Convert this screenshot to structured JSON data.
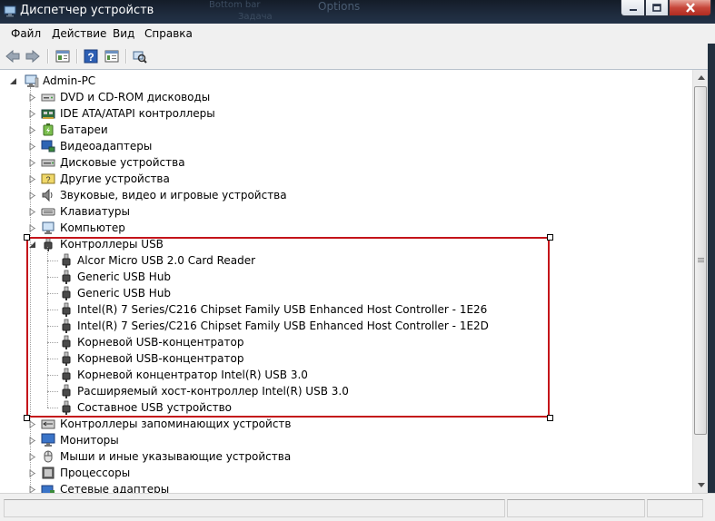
{
  "window": {
    "title": "Диспетчер устройств",
    "background_tabs": [
      "Оptions",
      "Bottom bar",
      "Задача"
    ]
  },
  "menu": [
    "Файл",
    "Действие",
    "Вид",
    "Справка"
  ],
  "toolbar": {
    "icons": [
      "back-arrow-icon",
      "forward-arrow-icon",
      "properties-icon",
      "help-icon",
      "console-tree-icon",
      "scan-hardware-icon"
    ]
  },
  "tree": {
    "root": "Admin-PC",
    "categories_before": [
      {
        "label": "DVD и CD-ROM дисководы",
        "icon": "dvd-drive-icon"
      },
      {
        "label": "IDE ATA/ATAPI контроллеры",
        "icon": "ide-controller-icon"
      },
      {
        "label": "Батареи",
        "icon": "battery-icon"
      },
      {
        "label": "Видеоадаптеры",
        "icon": "display-adapter-icon"
      },
      {
        "label": "Дисковые устройства",
        "icon": "disk-drive-icon"
      },
      {
        "label": "Другие устройства",
        "icon": "other-devices-icon"
      },
      {
        "label": "Звуковые, видео и игровые устройства",
        "icon": "sound-icon"
      },
      {
        "label": "Клавиатуры",
        "icon": "keyboard-icon"
      },
      {
        "label": "Компьютер",
        "icon": "computer-icon"
      }
    ],
    "usb": {
      "label": "Контроллеры USB",
      "icon": "usb-plug-icon",
      "children": [
        "Alcor Micro USB 2.0 Card Reader",
        "Generic USB Hub",
        "Generic USB Hub",
        "Intel(R) 7 Series/C216 Chipset Family USB Enhanced Host Controller - 1E26",
        "Intel(R) 7 Series/C216 Chipset Family USB Enhanced Host Controller - 1E2D",
        "Корневой USB-концентратор",
        "Корневой USB-концентратор",
        "Корневой концентратор Intel(R) USB 3.0",
        "Расширяемый хост-контроллер Intel(R) USB 3.0",
        "Составное USB устройство"
      ]
    },
    "categories_after": [
      {
        "label": "Контроллеры запоминающих устройств",
        "icon": "storage-controller-icon"
      },
      {
        "label": "Мониторы",
        "icon": "monitor-icon"
      },
      {
        "label": "Мыши и иные указывающие устройства",
        "icon": "mouse-icon"
      },
      {
        "label": "Процессоры",
        "icon": "processor-icon"
      },
      {
        "label": "Сетевые адаптеры",
        "icon": "network-adapter-icon"
      }
    ]
  },
  "colors": {
    "selection_outline": "#c4141a",
    "title_bar": "#1e2b3d"
  }
}
